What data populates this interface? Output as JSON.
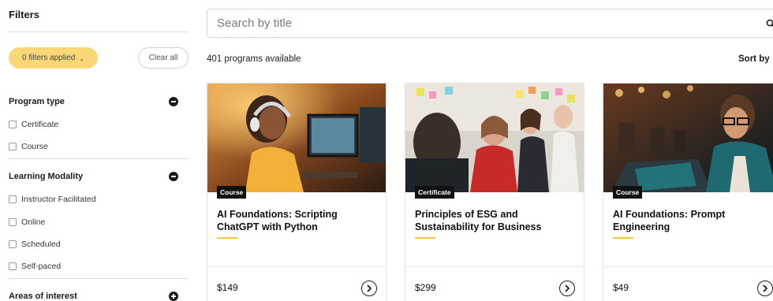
{
  "sidebar": {
    "title": "Filters",
    "filters_applied": "0 filters applied",
    "clear_all": "Clear all",
    "sections": [
      {
        "label": "Program type",
        "expanded": true,
        "options": [
          "Certificate",
          "Course"
        ]
      },
      {
        "label": "Learning Modality",
        "expanded": true,
        "options": [
          "Instructor Facilitated",
          "Online",
          "Scheduled",
          "Self-paced"
        ]
      },
      {
        "label": "Areas of interest",
        "expanded": false,
        "options": []
      }
    ]
  },
  "search": {
    "placeholder": "Search by title"
  },
  "results": {
    "count_text": "401 programs available",
    "sort_label": "Sort by"
  },
  "cards": [
    {
      "badge": "Course",
      "title": "AI Foundations: Scripting ChatGPT with Python",
      "price": "$149",
      "image": "woman-with-headphones-at-computer"
    },
    {
      "badge": "Certificate",
      "title": "Principles of ESG and Sustainability for Business",
      "price": "$299",
      "image": "group-discussion-with-sticky-notes"
    },
    {
      "badge": "Course",
      "title": "AI Foundations: Prompt Engineering",
      "price": "$49",
      "image": "man-with-glasses-at-laptop"
    }
  ],
  "colors": {
    "accent": "#f6c633",
    "pill": "#f8d774",
    "text": "#1a1a1a"
  }
}
